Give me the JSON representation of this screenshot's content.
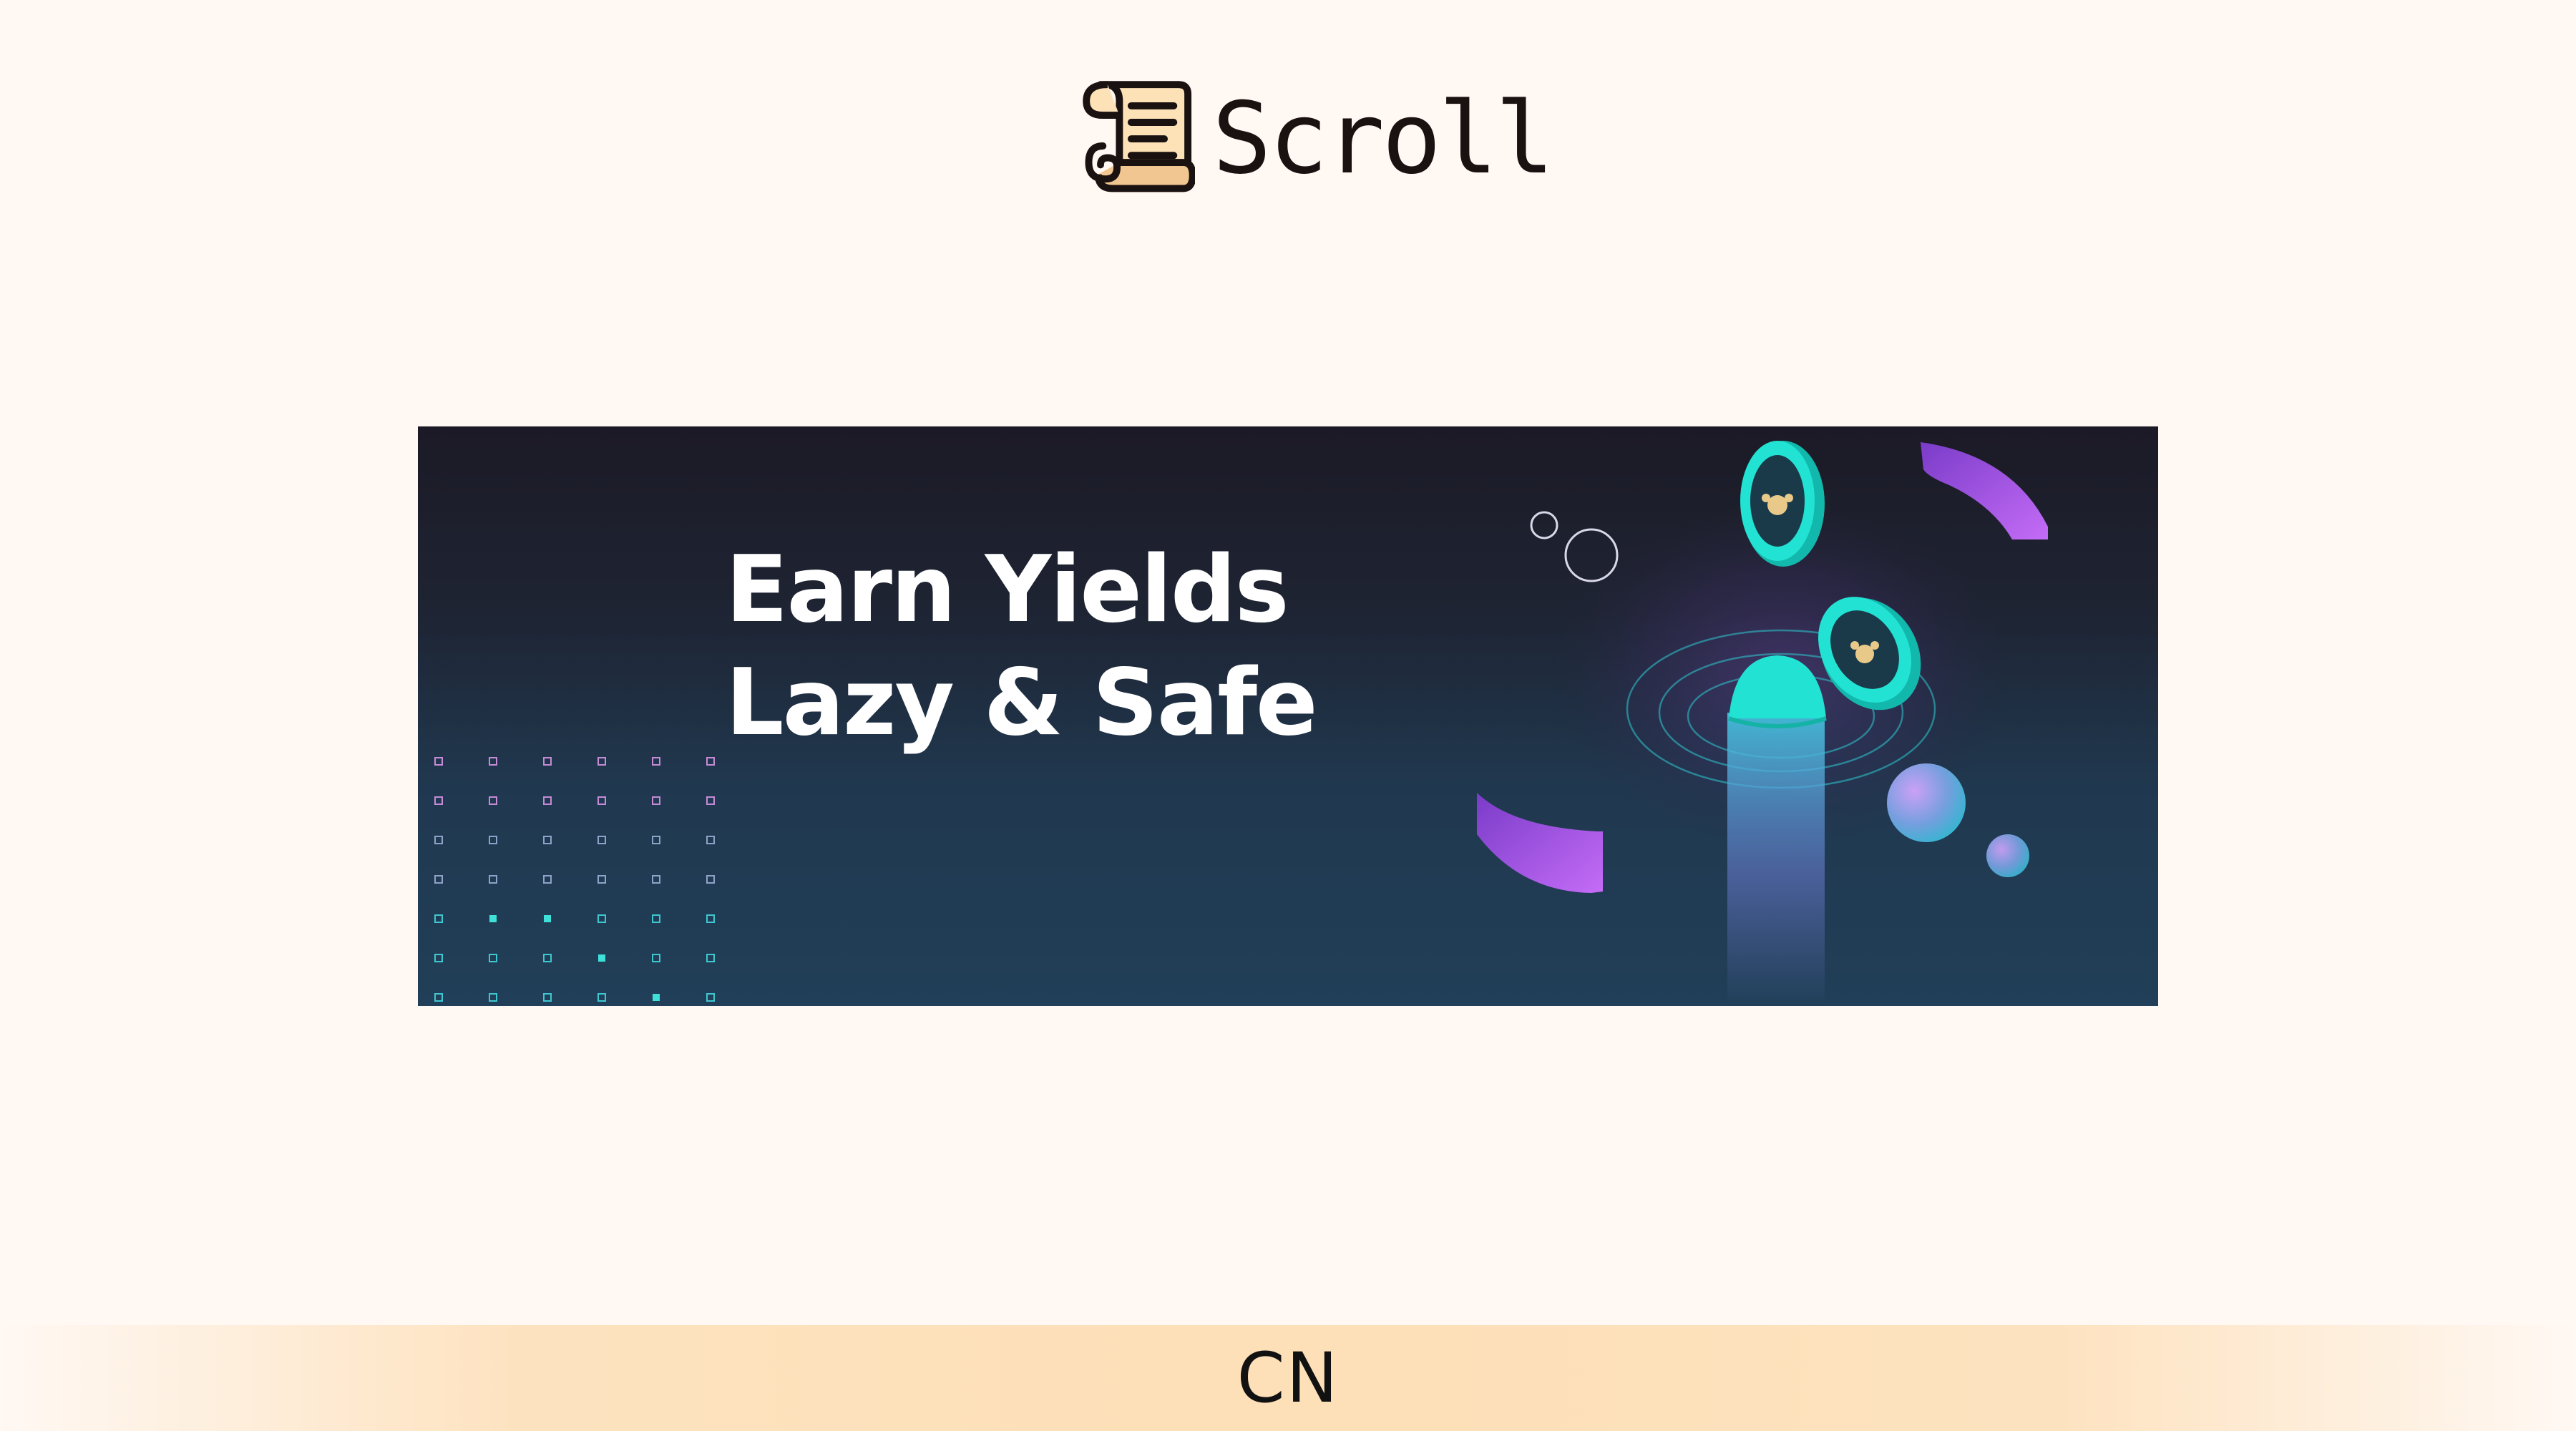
{
  "header": {
    "logo_icon": "scroll-logo-icon",
    "brand_name": "Scroll"
  },
  "banner": {
    "headline_line1": "Earn Yields",
    "headline_line2": "Lazy & Safe",
    "decor_icons": [
      "coin-icon",
      "coin-icon",
      "coin-icon",
      "ring-icon"
    ]
  },
  "footer": {
    "language": "CN"
  },
  "colors": {
    "page_background": "#fff8f3",
    "brand_text": "#1a1111",
    "banner_dark": "#1c1a26",
    "banner_blue": "#213f58",
    "accent_cyan": "#1ee3d6",
    "accent_purple": "#a855f7",
    "logo_tan": "#f2c690",
    "lang_bar": "#fde0b8"
  }
}
